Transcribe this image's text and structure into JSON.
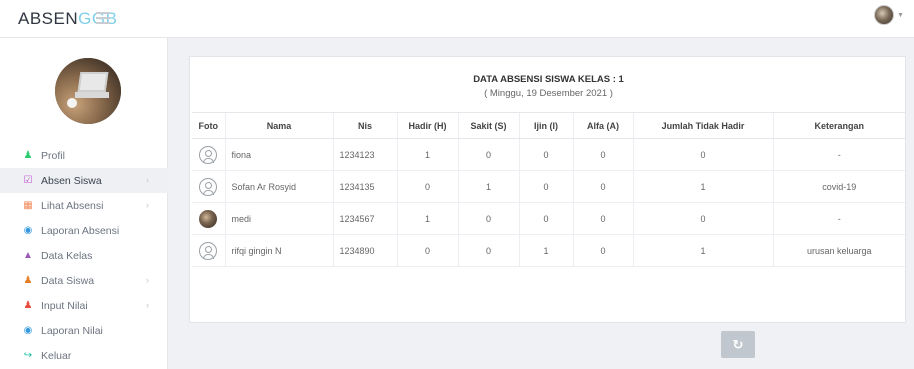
{
  "brand": {
    "part1": "ABSEN",
    "part2": "GGB"
  },
  "sidebar": {
    "items": [
      {
        "label": "Profil",
        "icon": "user-icon",
        "color": "#2ecc71",
        "glyph": "♟",
        "active": false,
        "has_arrow": false
      },
      {
        "label": "Absen Siswa",
        "icon": "check-square-icon",
        "color": "#c456d6",
        "glyph": "☑",
        "active": true,
        "has_arrow": true
      },
      {
        "label": "Lihat Absensi",
        "icon": "table-icon",
        "color": "#f08a5d",
        "glyph": "▦",
        "active": false,
        "has_arrow": true
      },
      {
        "label": "Laporan Absensi",
        "icon": "database-icon",
        "color": "#3498db",
        "glyph": "◉",
        "active": false,
        "has_arrow": false
      },
      {
        "label": "Data Kelas",
        "icon": "graduation-cap-icon",
        "color": "#9b59b6",
        "glyph": "▲",
        "active": false,
        "has_arrow": false
      },
      {
        "label": "Data Siswa",
        "icon": "users-icon",
        "color": "#e67e22",
        "glyph": "♟",
        "active": false,
        "has_arrow": true
      },
      {
        "label": "Input Nilai",
        "icon": "users-icon",
        "color": "#e74c3c",
        "glyph": "♟",
        "active": false,
        "has_arrow": true
      },
      {
        "label": "Laporan Nilai",
        "icon": "database-icon",
        "color": "#3498db",
        "glyph": "◉",
        "active": false,
        "has_arrow": false
      },
      {
        "label": "Keluar",
        "icon": "sign-out-icon",
        "color": "#1abc9c",
        "glyph": "↪",
        "active": false,
        "has_arrow": false
      }
    ]
  },
  "panel": {
    "title": "DATA ABSENSI SISWA KELAS : 1",
    "subtitle": "( Minggu, 19 Desember 2021 )"
  },
  "table": {
    "headers": [
      "Foto",
      "Nama",
      "Nis",
      "Hadir (H)",
      "Sakit (S)",
      "Ijin (I)",
      "Alfa (A)",
      "Jumlah Tidak Hadir",
      "Keterangan"
    ],
    "rows": [
      {
        "photo": "placeholder",
        "nama": "fiona",
        "nis": "1234123",
        "hadir": "1",
        "sakit": "0",
        "ijin": "0",
        "alfa": "0",
        "jumlah": "0",
        "keterangan": "-"
      },
      {
        "photo": "placeholder",
        "nama": "Sofan Ar Rosyid",
        "nis": "1234135",
        "hadir": "0",
        "sakit": "1",
        "ijin": "0",
        "alfa": "0",
        "jumlah": "1",
        "keterangan": "covid-19"
      },
      {
        "photo": "real",
        "nama": "medi",
        "nis": "1234567",
        "hadir": "1",
        "sakit": "0",
        "ijin": "0",
        "alfa": "0",
        "jumlah": "0",
        "keterangan": "-"
      },
      {
        "photo": "placeholder",
        "nama": "rifqi gingin N",
        "nis": "1234890",
        "hadir": "0",
        "sakit": "0",
        "ijin": "1",
        "alfa": "0",
        "jumlah": "1",
        "keterangan": "urusan keluarga"
      }
    ]
  },
  "refresh": {
    "icon": "refresh-icon",
    "glyph": "↻"
  }
}
